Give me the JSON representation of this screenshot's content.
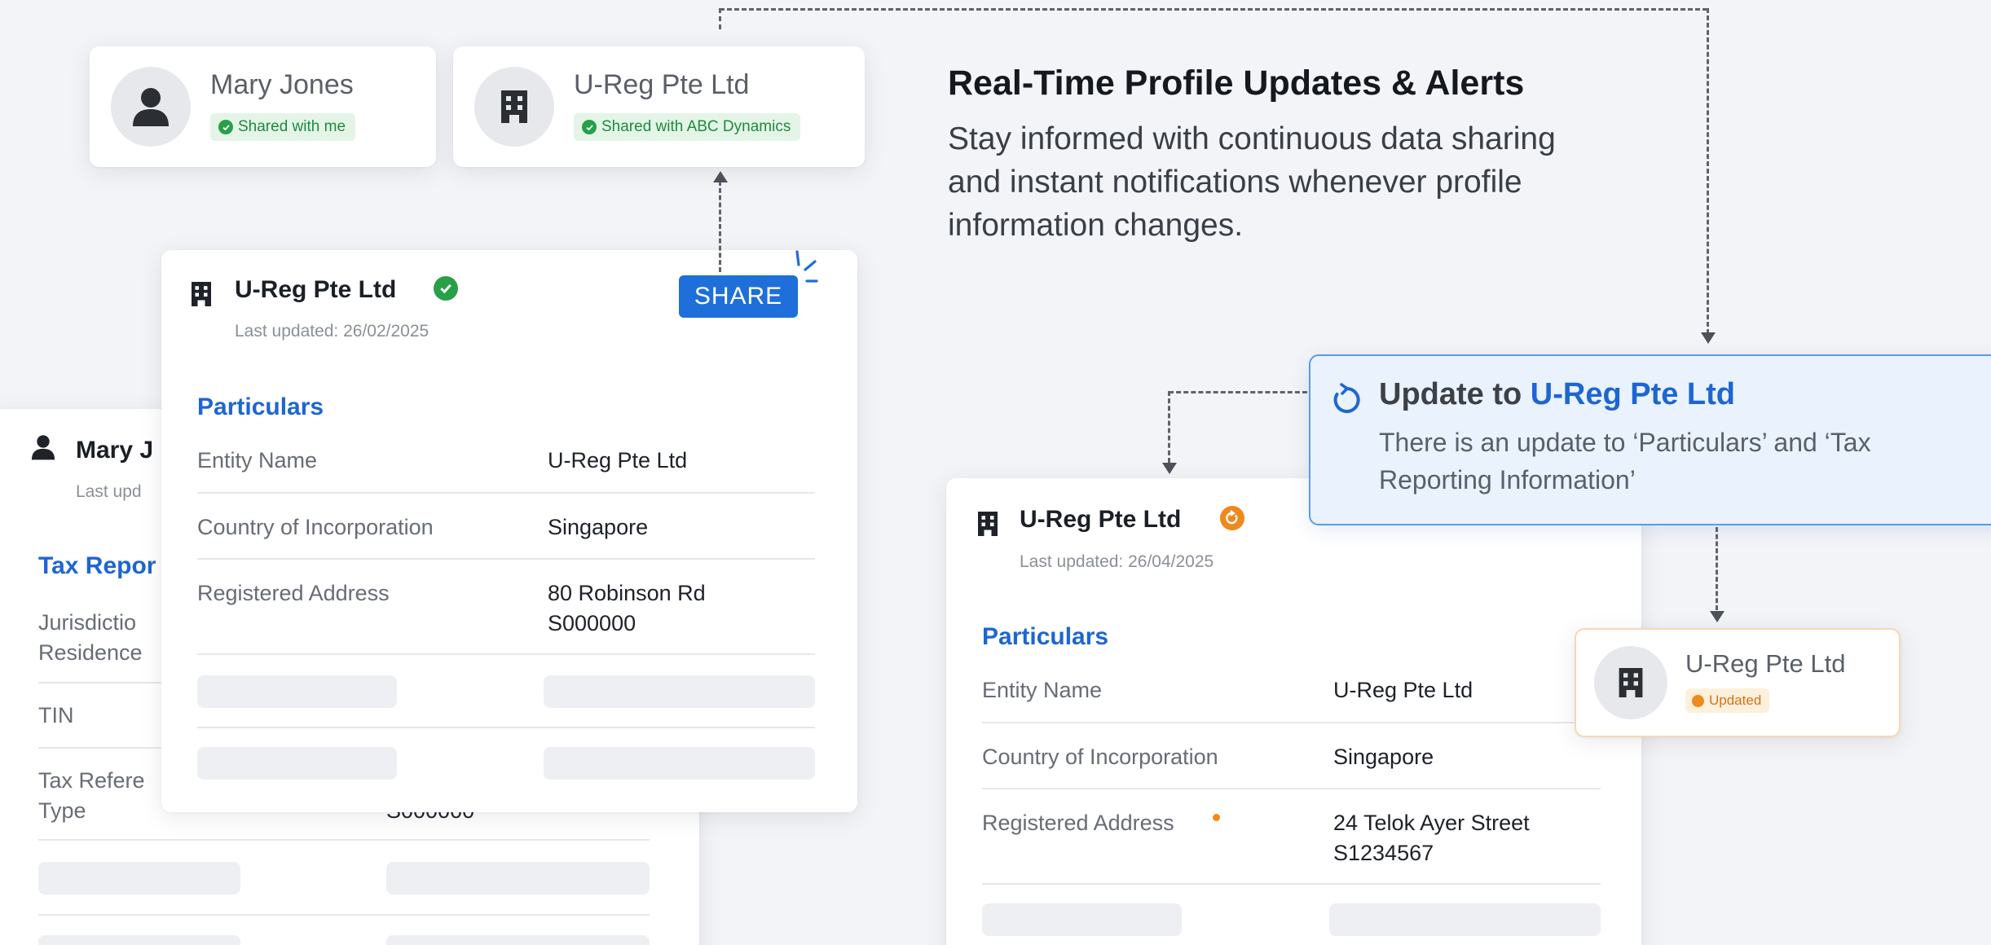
{
  "profile_cards": {
    "mary": {
      "name": "Mary Jones",
      "badge": "Shared with me"
    },
    "ureg": {
      "name": "U-Reg Pte Ltd",
      "badge": "Shared with ABC Dynamics"
    }
  },
  "headline": {
    "title": "Real-Time Profile Updates & Alerts",
    "description": "Stay informed with continuous data sharing and instant notifications whenever profile information changes."
  },
  "back_card": {
    "name": "Mary J",
    "last_updated": "Last upd",
    "section": "Tax Repor",
    "rows": [
      {
        "label": "Jurisdictio\nResidence"
      },
      {
        "label": "TIN"
      },
      {
        "label": "Tax Refere\nType",
        "value": "S000000"
      }
    ]
  },
  "main_card": {
    "title": "U-Reg Pte Ltd",
    "last_updated": "Last updated: 26/02/2025",
    "share_label": "SHARE",
    "section": "Particulars",
    "rows": [
      {
        "label": "Entity Name",
        "value": "U-Reg Pte Ltd"
      },
      {
        "label": "Country of Incorporation",
        "value": "Singapore"
      },
      {
        "label": "Registered Address",
        "value": "80 Robinson Rd\nS000000"
      }
    ]
  },
  "notification": {
    "title_prefix": "Update to ",
    "title_entity": "U-Reg Pte Ltd",
    "body": "There is an update to ‘Particulars’ and ‘Tax Reporting Information’"
  },
  "updated_card": {
    "title": "U-Reg Pte Ltd",
    "last_updated": "Last updated: 26/04/2025",
    "section": "Particulars",
    "rows": [
      {
        "label": "Entity Name",
        "value": "U-Reg Pte Ltd"
      },
      {
        "label": "Country of Incorporation",
        "value": "Singapore"
      },
      {
        "label": "Registered Address",
        "value": "24 Telok Ayer Street\nS1234567"
      }
    ]
  },
  "mini_updated": {
    "name": "U-Reg Pte Ltd",
    "badge": "Updated"
  },
  "colors": {
    "accent_blue": "#1e66d0",
    "share_blue": "#1e6fd9",
    "success_green": "#27a047",
    "update_orange": "#f0891c",
    "notification_bg": "#e9f2fd"
  },
  "icons": [
    "person-icon",
    "building-icon",
    "check-circle-icon",
    "refresh-icon",
    "sparkle-icon"
  ]
}
